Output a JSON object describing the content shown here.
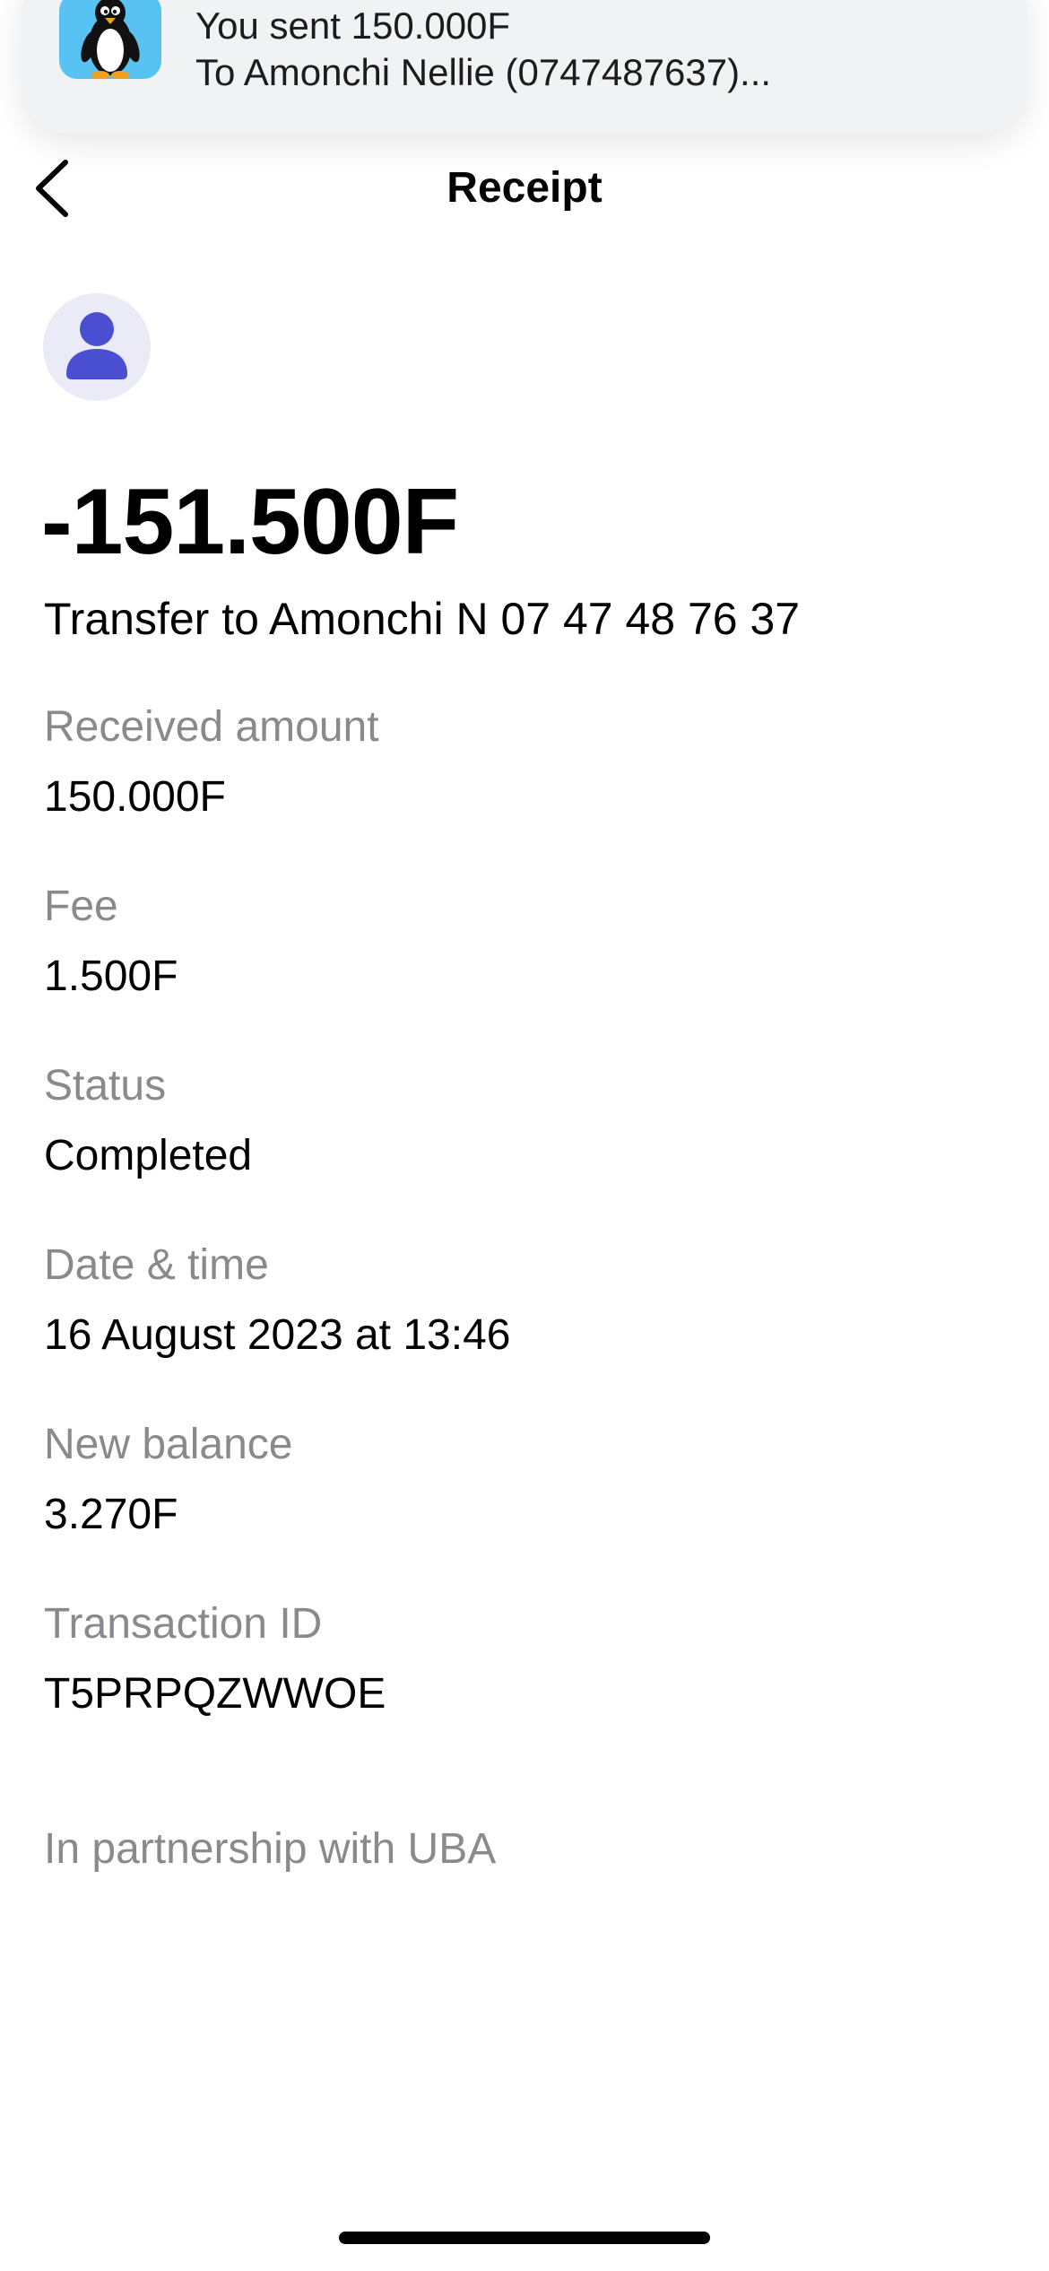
{
  "notification": {
    "app_icon": "penguin-app-icon",
    "line1": "You sent 150.000F",
    "line2": "To Amonchi Nellie (0747487637)..."
  },
  "header": {
    "back_icon": "chevron-left-icon",
    "title": "Receipt"
  },
  "avatar": {
    "icon": "person-icon",
    "color": "#4a4fd1",
    "background": "#ebebf7"
  },
  "transaction": {
    "amount": "-151.500F",
    "description": "Transfer to Amonchi N 07 47 48 76 37"
  },
  "details": [
    {
      "label": "Received amount",
      "value": "150.000F"
    },
    {
      "label": "Fee",
      "value": "1.500F"
    },
    {
      "label": "Status",
      "value": "Completed"
    },
    {
      "label": "Date & time",
      "value": "16 August 2023 at 13:46"
    },
    {
      "label": "New balance",
      "value": "3.270F"
    },
    {
      "label": "Transaction ID",
      "value": "T5PRPQZWWOE"
    }
  ],
  "footer": {
    "partnership": "In partnership with UBA"
  }
}
